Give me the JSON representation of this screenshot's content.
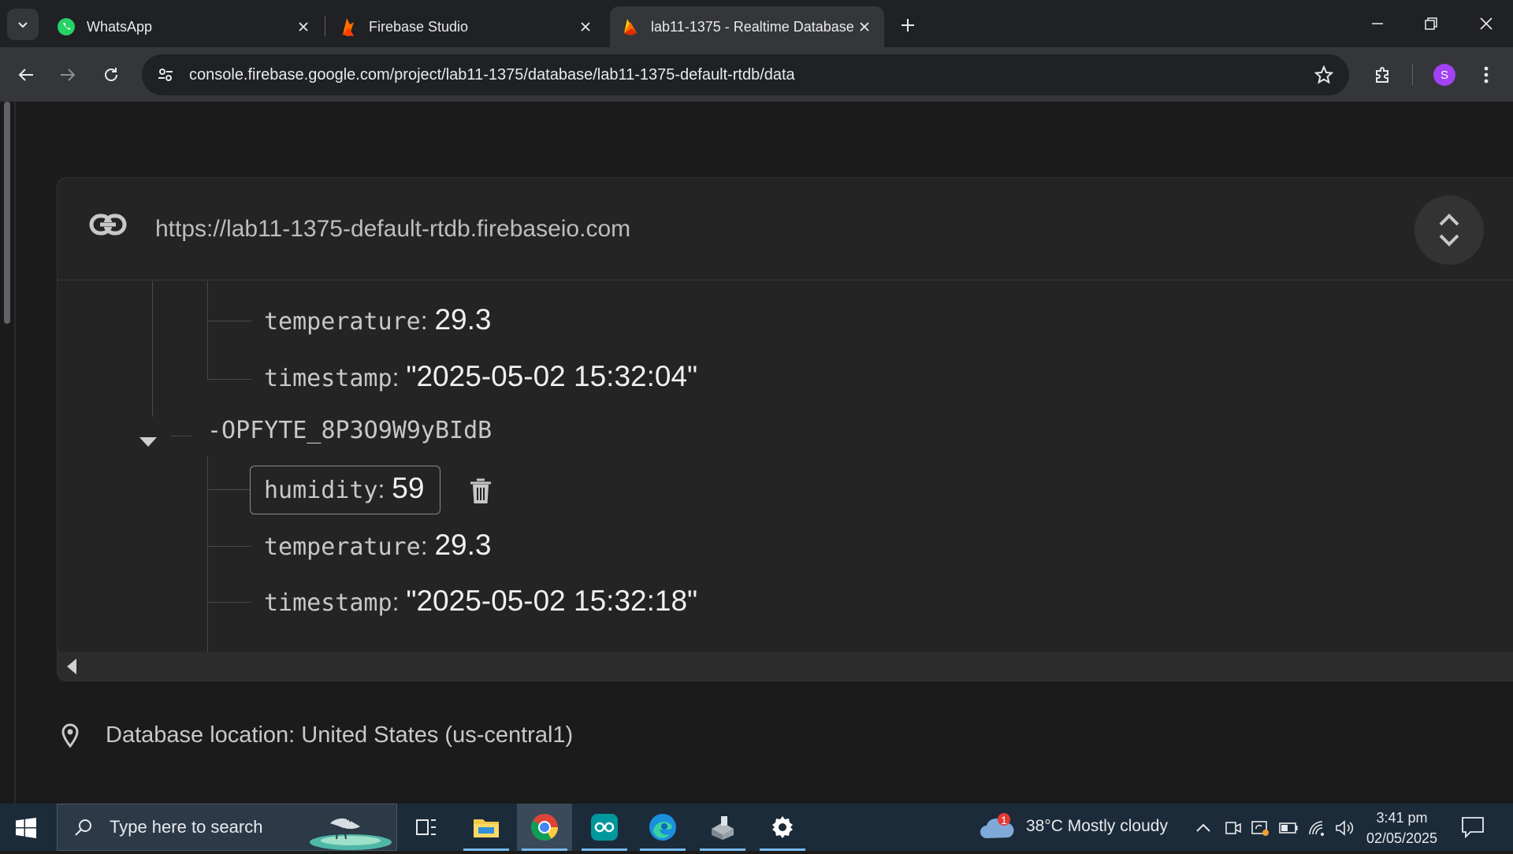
{
  "browser": {
    "tabs": [
      {
        "title": "WhatsApp",
        "icon": "whatsapp-icon",
        "color": "#25d366"
      },
      {
        "title": "Firebase Studio",
        "icon": "firebase-studio-icon",
        "color": "#ff6d00"
      },
      {
        "title": "lab11-1375 - Realtime Database",
        "icon": "firebase-icon",
        "color": "#ffa000"
      }
    ],
    "url": "console.firebase.google.com/project/lab11-1375/database/lab11-1375-default-rtdb/data",
    "profile_initial": "S"
  },
  "database": {
    "url": "https://lab11-1375-default-rtdb.firebaseio.com",
    "prev_entry": {
      "temperature_key": "temperature",
      "temperature_value": "29.3",
      "timestamp_key": "timestamp",
      "timestamp_value": "\"2025-05-02 15:32:04\""
    },
    "node": {
      "key": "-OPFYTE_8P3O9W9yBIdB",
      "humidity_key": "humidity",
      "humidity_value": "59",
      "temperature_key": "temperature",
      "temperature_value": "29.3",
      "timestamp_key": "timestamp",
      "timestamp_value": "\"2025-05-02 15:32:18\""
    },
    "location": "Database location: United States (us-central1)"
  },
  "taskbar": {
    "search_placeholder": "Type here to search",
    "apps": [
      "task-view-icon",
      "file-explorer-icon",
      "chrome-icon",
      "arduino-icon",
      "edge-icon",
      "app-icon",
      "settings-icon"
    ],
    "weather_badge": "1",
    "weather_text": "38°C  Mostly cloudy",
    "time": "3:41 pm",
    "date": "02/05/2025"
  }
}
